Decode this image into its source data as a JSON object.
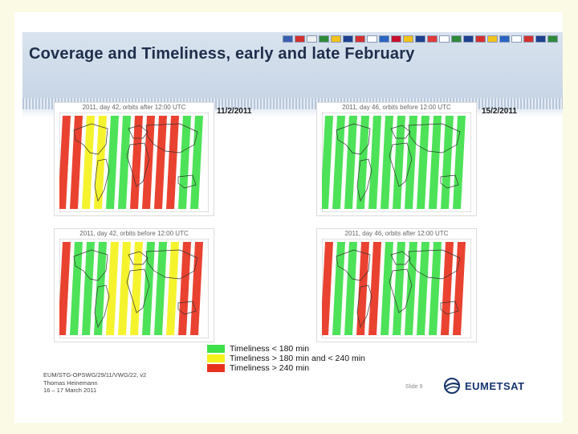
{
  "slide": {
    "title": "Coverage and Timeliness, early and late February",
    "date_left": "11/2/2011",
    "date_right": "15/2/2011",
    "panels": [
      {
        "caption": "2011, day 42, orbits after 12:00 UTC"
      },
      {
        "caption": "2011, day 46, orbits before 12:00 UTC"
      },
      {
        "caption": "2011, day 42, orbits before 12:00 UTC"
      },
      {
        "caption": "2011, day 46, orbits after 12:00 UTC"
      }
    ],
    "legend": [
      {
        "label": "Timeliness < 180 min",
        "color": "#3ee04a"
      },
      {
        "label": "Timeliness > 180 min and < 240 min",
        "color": "#f4f21c"
      },
      {
        "label": "Timeliness > 240 min",
        "color": "#e8321e"
      }
    ],
    "footer": {
      "line1": "EUM/STG-OPSWG/29/11/VWG/22, v2",
      "line2": "Thomas Heinemann",
      "line3": "16 – 17 March 2011"
    },
    "slide_number": "Slide 9",
    "logo_text": "EUMETSAT",
    "colors": {
      "green": "#3ee04a",
      "yellow": "#f4f21c",
      "red": "#e8321e",
      "title": "#1e2e4a"
    }
  }
}
